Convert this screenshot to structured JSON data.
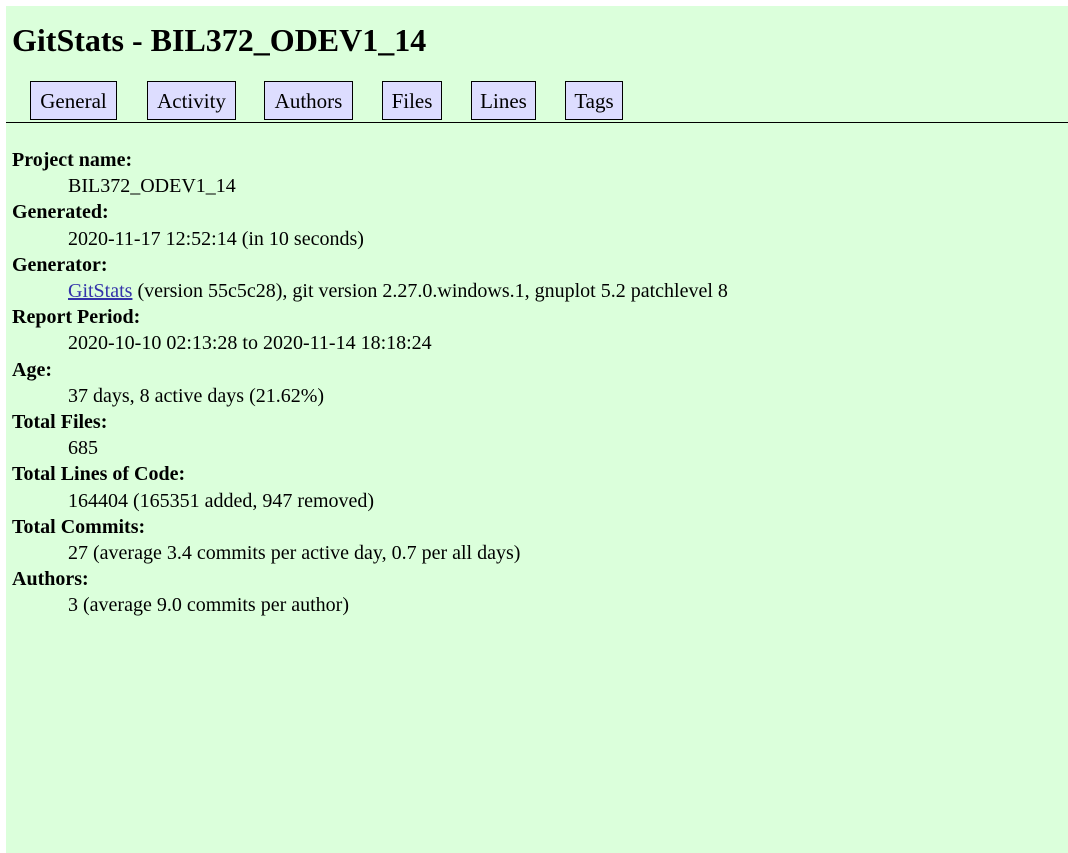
{
  "header": {
    "title": "GitStats - BIL372_ODEV1_14"
  },
  "nav": {
    "tabs": [
      {
        "label": "General"
      },
      {
        "label": "Activity"
      },
      {
        "label": "Authors"
      },
      {
        "label": "Files"
      },
      {
        "label": "Lines"
      },
      {
        "label": "Tags"
      }
    ]
  },
  "stats": {
    "project_name": {
      "label": "Project name:",
      "value": "BIL372_ODEV1_14"
    },
    "generated": {
      "label": "Generated:",
      "value": "2020-11-17 12:52:14 (in 10 seconds)"
    },
    "generator": {
      "label": "Generator:",
      "link_text": "GitStats",
      "value_rest": " (version 55c5c28), git version 2.27.0.windows.1, gnuplot 5.2 patchlevel 8"
    },
    "report_period": {
      "label": "Report Period:",
      "value": "2020-10-10 02:13:28 to 2020-11-14 18:18:24"
    },
    "age": {
      "label": "Age:",
      "value": "37 days, 8 active days (21.62%)"
    },
    "total_files": {
      "label": "Total Files:",
      "value": "685"
    },
    "total_lines": {
      "label": "Total Lines of Code:",
      "value": "164404 (165351 added, 947 removed)"
    },
    "total_commits": {
      "label": "Total Commits:",
      "value": "27 (average 3.4 commits per active day, 0.7 per all days)"
    },
    "authors": {
      "label": "Authors:",
      "value": "3 (average 9.0 commits per author)"
    }
  },
  "colors": {
    "page_background": "#dbffdb",
    "tab_background": "#ddddff",
    "link": "#3333aa"
  }
}
